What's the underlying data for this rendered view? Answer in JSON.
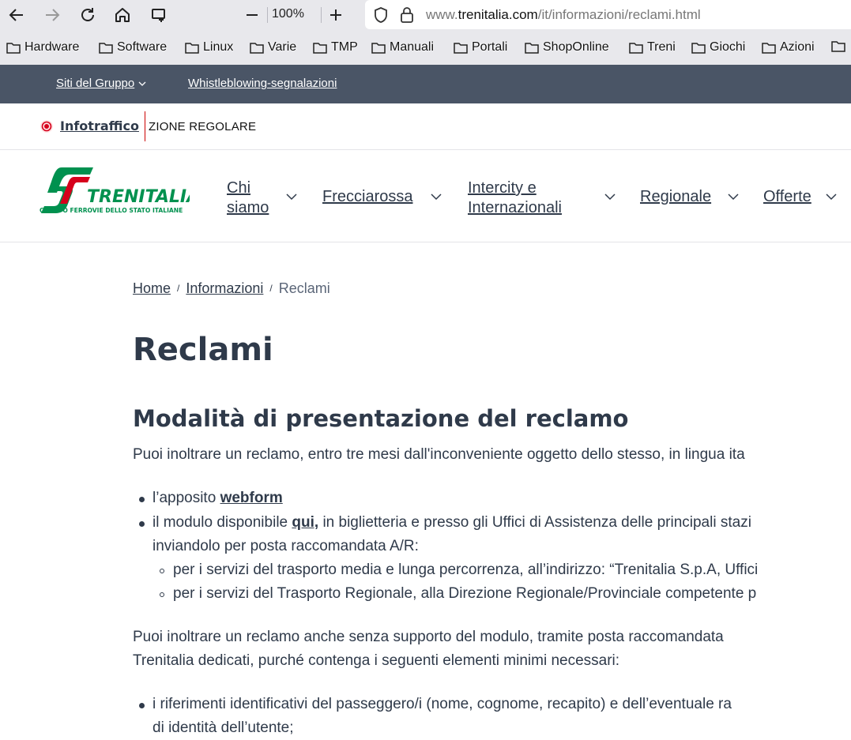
{
  "browser": {
    "zoom_level": "100%",
    "url_prefix": "www.",
    "url_domain": "trenitalia.com",
    "url_path": "/it/informazioni/reclami.html"
  },
  "bookmarks": [
    "Hardware",
    "Software",
    "Linux",
    "Varie",
    "TMP",
    "Manuali",
    "Portali",
    "ShopOnline",
    "Treni",
    "Giochi",
    "Azioni"
  ],
  "group_bar": {
    "siti": "Siti del Gruppo",
    "whistle": "Whistleblowing-segnalazioni"
  },
  "info": {
    "label": "Infotraffico",
    "ticker": "ZIONE REGOLARE"
  },
  "nav": {
    "logo_text": "TRENITALIA",
    "logo_sub": "GRUPPO FERROVIE DELLO STATO ITALIANE",
    "chi_1": "Chi",
    "chi_2": "siamo",
    "freccia": "Frecciarossa",
    "ic_1": "Intercity e",
    "ic_2": "Internazionali",
    "regionale": "Regionale",
    "offerte": "Offerte"
  },
  "breadcrumb": {
    "home": "Home",
    "info": "Informazioni",
    "current": "Reclami"
  },
  "content": {
    "title": "Reclami",
    "subtitle": "Modalità di presentazione del reclamo",
    "intro": "Puoi inoltrare un reclamo, entro tre mesi dall'inconveniente oggetto dello stesso, in lingua ita",
    "li1_pre": "l’apposito ",
    "li1_link": "webform",
    "li2_pre": "il modulo disponibile ",
    "li2_link": "qui,",
    "li2_post": " in biglietteria e presso gli Uffici di Assistenza delle principali stazi",
    "li2_line2": "inviandolo per posta raccomandata A/R:",
    "sub1": "per i servizi del trasporto media e lunga percorrenza, all’indirizzo: “Trenitalia S.p.A, Uffici",
    "sub2": "per i servizi del Trasporto Regionale, alla Direzione Regionale/Provinciale competente p",
    "para2_l1": "Puoi inoltrare un reclamo anche senza supporto del modulo, tramite posta raccomandata",
    "para2_l2": "Trenitalia dedicati, purché contenga i seguenti elementi minimi necessari:",
    "li3_l1": "i riferimenti identificativi del passeggero/i (nome, cognome, recapito) e dell’eventuale ra",
    "li3_l2": "di identità dell’utente;"
  },
  "colors": {
    "nav_dark": "#4a5566",
    "text": "#2f3a4a",
    "brand_green": "#00914f",
    "brand_red": "#d6001c"
  }
}
